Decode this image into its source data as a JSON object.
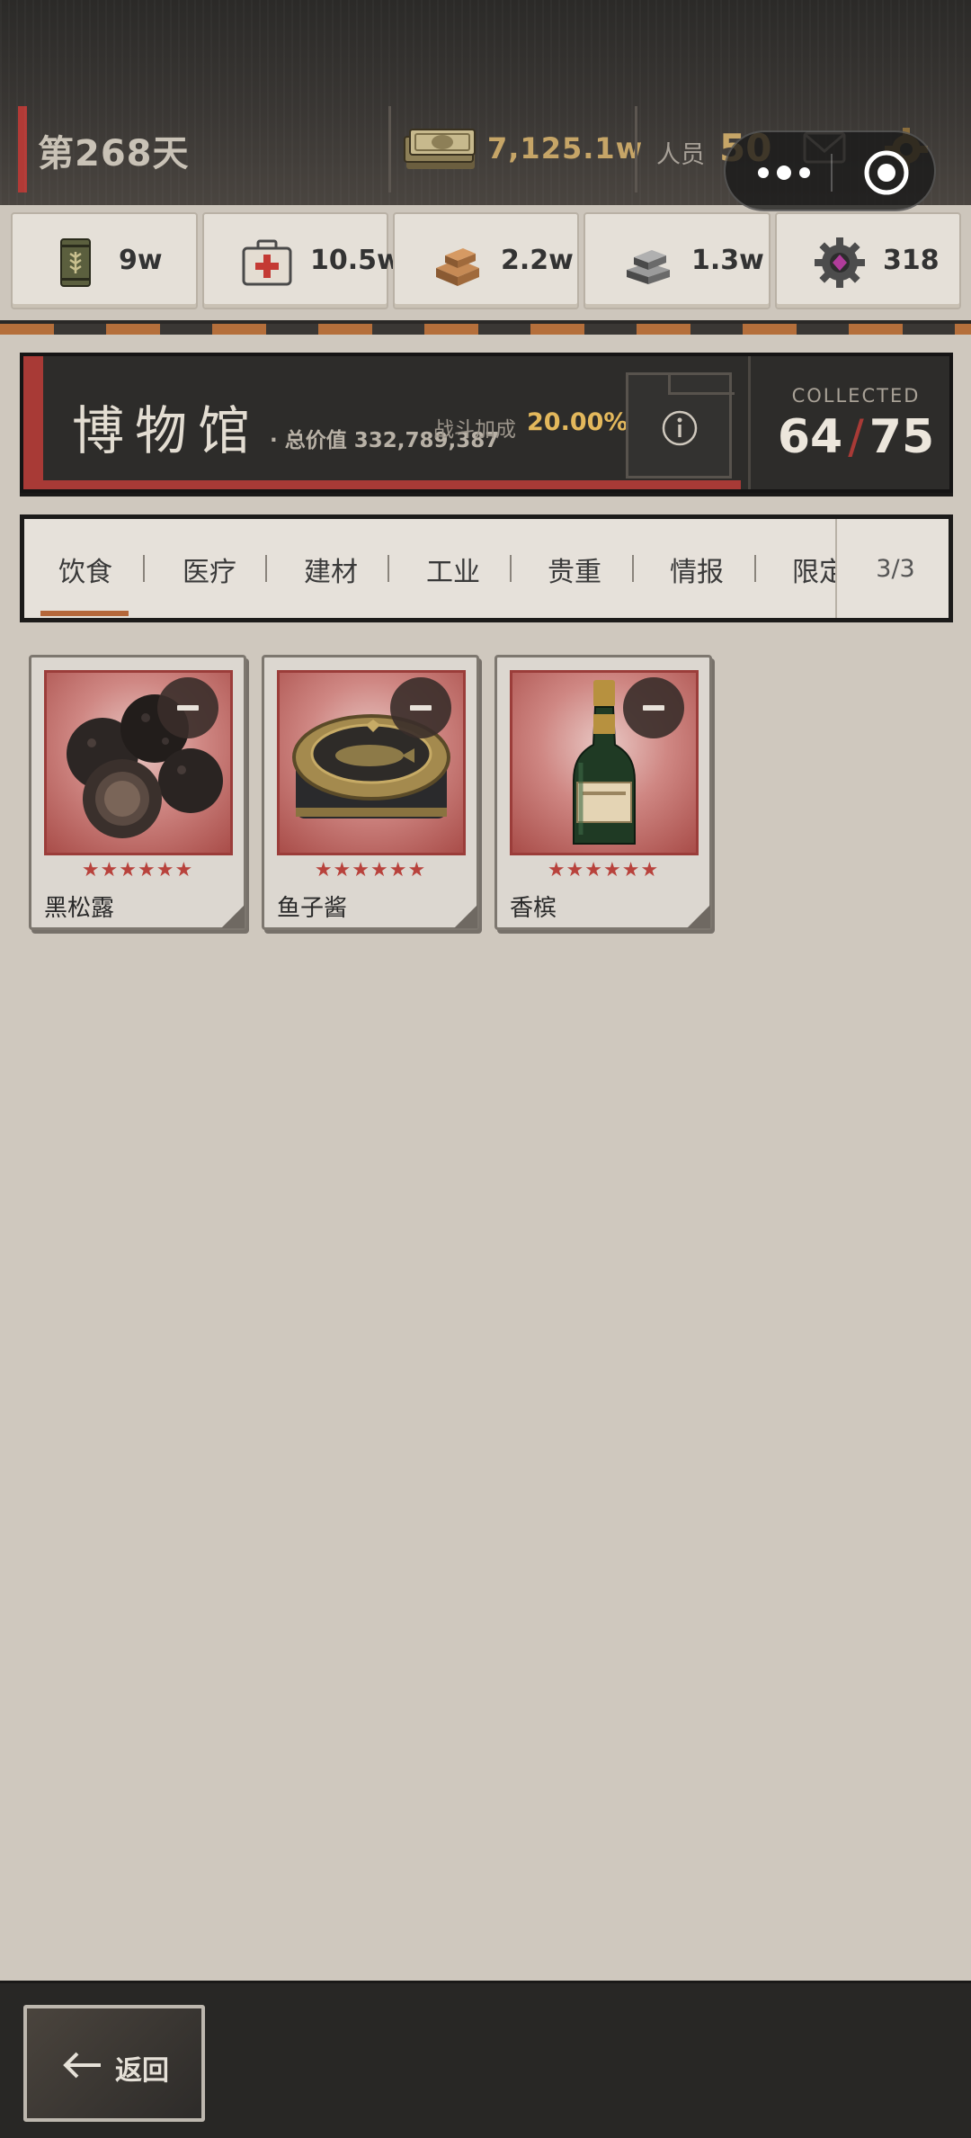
{
  "header": {
    "day": "第268天",
    "cash": "7,125.1w",
    "staff_label": "人员",
    "staff_count": "50"
  },
  "resources": [
    {
      "icon": "grain-can-icon",
      "value": "9w"
    },
    {
      "icon": "medkit-icon",
      "value": "10.5w"
    },
    {
      "icon": "lumber-icon",
      "value": "2.2w"
    },
    {
      "icon": "steel-ingot-icon",
      "value": "1.3w"
    },
    {
      "icon": "gear-gem-icon",
      "value": "318"
    }
  ],
  "museum": {
    "title": "博物馆",
    "total_value": "· 总价值 332,789,387",
    "bonus_label": "战斗加成",
    "bonus_value": "20.00%",
    "collected_label": "COLLECTED",
    "collected": "64",
    "collected_total": "75"
  },
  "tabs": [
    "饮食",
    "医疗",
    "建材",
    "工业",
    "贵重",
    "情报",
    "限定"
  ],
  "active_tab": "饮食",
  "page_indicator": "3/3",
  "items": [
    {
      "name": "黑松露",
      "stars": "★★★★★★",
      "icon": "black-truffle-icon"
    },
    {
      "name": "鱼子酱",
      "stars": "★★★★★★",
      "icon": "caviar-tin-icon"
    },
    {
      "name": "香槟",
      "stars": "★★★★★★",
      "icon": "champagne-bottle-icon"
    }
  ],
  "footer": {
    "back_label": "返回"
  },
  "colors": {
    "accent_red": "#a83a36",
    "gold": "#c6a567",
    "bonus_gold": "#e3b85c",
    "tab_underline": "#b4673a"
  }
}
